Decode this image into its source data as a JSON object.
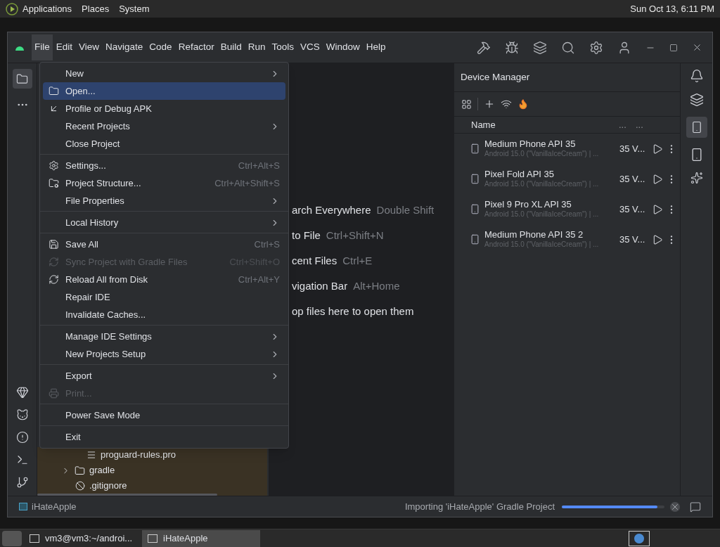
{
  "top_panel": {
    "menus": [
      "Applications",
      "Places",
      "System"
    ],
    "clock": "Sun Oct 13,  6:11 PM"
  },
  "menubar": [
    {
      "label": "File",
      "selected": true
    },
    {
      "label": "Edit",
      "selected": false
    },
    {
      "label": "View",
      "selected": false
    },
    {
      "label": "Navigate",
      "selected": false
    },
    {
      "label": "Code",
      "selected": false
    },
    {
      "label": "Refactor",
      "selected": false
    },
    {
      "label": "Build",
      "selected": false
    },
    {
      "label": "Run",
      "selected": false
    },
    {
      "label": "Tools",
      "selected": false
    },
    {
      "label": "VCS",
      "selected": false
    },
    {
      "label": "Window",
      "selected": false
    },
    {
      "label": "Help",
      "selected": false
    }
  ],
  "file_menu": [
    [
      {
        "label": "New",
        "submenu": true,
        "disabled": false,
        "selected": false
      },
      {
        "label": "Open...",
        "submenu": false,
        "disabled": false,
        "selected": true
      },
      {
        "label": "Profile or Debug APK",
        "submenu": false,
        "disabled": false,
        "selected": false
      },
      {
        "label": "Recent Projects",
        "submenu": true,
        "disabled": false,
        "selected": false
      },
      {
        "label": "Close Project",
        "submenu": false,
        "disabled": false,
        "selected": false
      }
    ],
    [
      {
        "label": "Settings...",
        "shortcut": "Ctrl+Alt+S",
        "submenu": false,
        "disabled": false,
        "selected": false
      },
      {
        "label": "Project Structure...",
        "shortcut": "Ctrl+Alt+Shift+S",
        "submenu": false,
        "disabled": false,
        "selected": false
      },
      {
        "label": "File Properties",
        "submenu": true,
        "disabled": false,
        "selected": false
      }
    ],
    [
      {
        "label": "Local History",
        "submenu": true,
        "disabled": false,
        "selected": false
      }
    ],
    [
      {
        "label": "Save All",
        "shortcut": "Ctrl+S",
        "submenu": false,
        "disabled": false,
        "selected": false
      },
      {
        "label": "Sync Project with Gradle Files",
        "shortcut": "Ctrl+Shift+O",
        "submenu": false,
        "disabled": true,
        "selected": false
      },
      {
        "label": "Reload All from Disk",
        "shortcut": "Ctrl+Alt+Y",
        "submenu": false,
        "disabled": false,
        "selected": false
      },
      {
        "label": "Repair IDE",
        "submenu": false,
        "disabled": false,
        "selected": false
      },
      {
        "label": "Invalidate Caches...",
        "submenu": false,
        "disabled": false,
        "selected": false
      }
    ],
    [
      {
        "label": "Manage IDE Settings",
        "submenu": true,
        "disabled": false,
        "selected": false
      },
      {
        "label": "New Projects Setup",
        "submenu": true,
        "disabled": false,
        "selected": false
      }
    ],
    [
      {
        "label": "Export",
        "submenu": true,
        "disabled": false,
        "selected": false
      },
      {
        "label": "Print...",
        "submenu": false,
        "disabled": true,
        "selected": false
      }
    ],
    [
      {
        "label": "Power Save Mode",
        "submenu": false,
        "disabled": false,
        "selected": false
      }
    ],
    [
      {
        "label": "Exit",
        "submenu": false,
        "disabled": false,
        "selected": false
      }
    ]
  ],
  "project_tree": [
    {
      "label": "proguard-rules.pro",
      "kind": "file"
    },
    {
      "label": "gradle",
      "kind": "folder"
    },
    {
      "label": ".gitignore",
      "kind": "ignore"
    }
  ],
  "editor_hints": [
    {
      "action": "arch Everywhere",
      "shortcut": "Double Shift"
    },
    {
      "action": "to File",
      "shortcut": "Ctrl+Shift+N"
    },
    {
      "action": "cent Files",
      "shortcut": "Ctrl+E"
    },
    {
      "action": "vigation Bar",
      "shortcut": "Alt+Home"
    },
    {
      "action": "op files here to open them"
    }
  ],
  "device_manager": {
    "title": "Device Manager",
    "columns": [
      "Name",
      "...",
      "..."
    ],
    "devices": [
      {
        "name": "Medium Phone API 35",
        "detail": "Android 15.0 (\"VanillaIceCream\") | ...",
        "api": "35 V..."
      },
      {
        "name": "Pixel Fold API 35",
        "detail": "Android 15.0 (\"VanillaIceCream\") | ...",
        "api": "35 V..."
      },
      {
        "name": "Pixel 9 Pro XL API 35",
        "detail": "Android 15.0 (\"VanillaIceCream\") | ...",
        "api": "35 V..."
      },
      {
        "name": "Medium Phone API 35 2",
        "detail": "Android 15.0 (\"VanillaIceCream\") | ...",
        "api": "35 V..."
      }
    ]
  },
  "status_bar": {
    "project": "iHateApple",
    "task": "Importing 'iHateApple' Gradle Project",
    "level": 0.93
  },
  "taskbar": [
    {
      "label": "vm3@vm3:~/androi...",
      "selected": false
    },
    {
      "label": "iHateApple",
      "selected": true
    }
  ]
}
